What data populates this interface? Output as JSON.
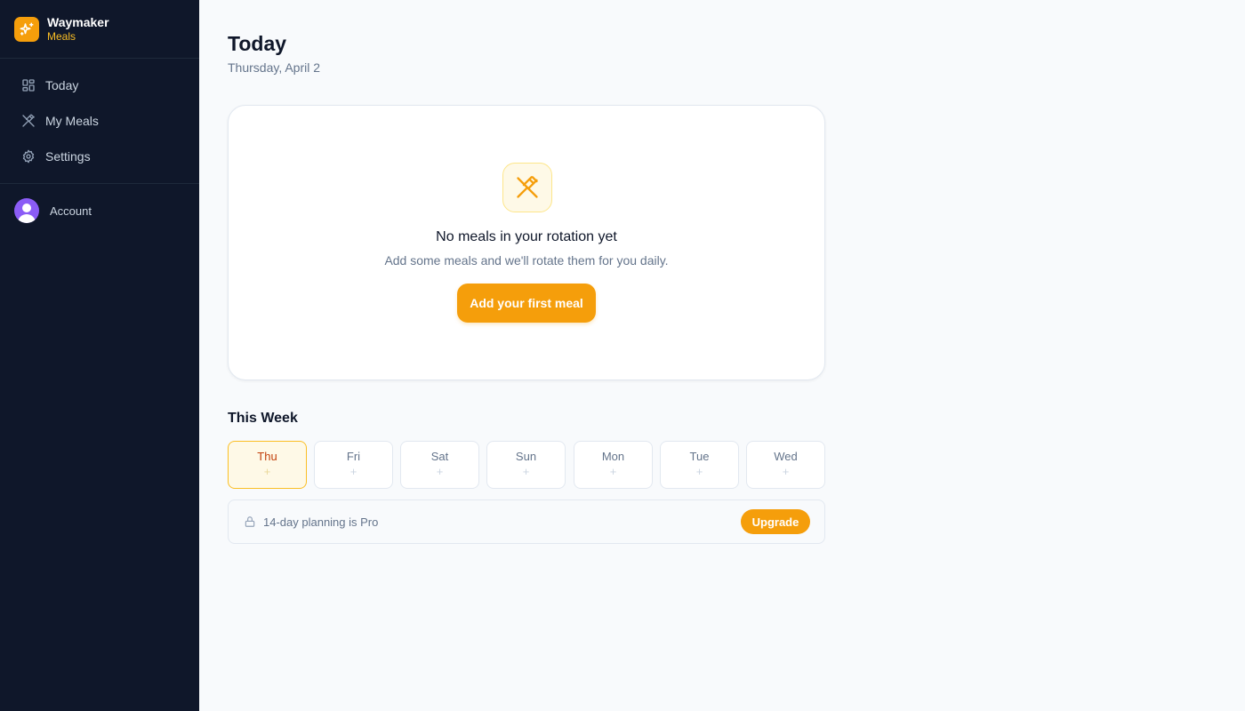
{
  "brand": {
    "name": "Waymaker",
    "subtitle": "Meals",
    "logo_icon": "sparkles-icon",
    "accent": "#f59e0b"
  },
  "sidebar": {
    "items": [
      {
        "label": "Today",
        "icon": "dashboard-icon"
      },
      {
        "label": "My Meals",
        "icon": "utensils-crossed-icon"
      },
      {
        "label": "Settings",
        "icon": "gear-icon"
      }
    ],
    "account": {
      "label": "Account",
      "icon": "user-avatar"
    }
  },
  "header": {
    "title": "Today",
    "date": "Thursday, April 2"
  },
  "empty_state": {
    "icon": "utensils-crossed-icon",
    "title": "No meals in your rotation yet",
    "description": "Add some meals and we'll rotate them for you daily.",
    "button": "Add your first meal"
  },
  "week": {
    "title": "This Week",
    "days": [
      {
        "name": "Thu",
        "plus": "+",
        "active": true
      },
      {
        "name": "Fri",
        "plus": "+"
      },
      {
        "name": "Sat",
        "plus": "+"
      },
      {
        "name": "Sun",
        "plus": "+"
      },
      {
        "name": "Mon",
        "plus": "+"
      },
      {
        "name": "Tue",
        "plus": "+"
      },
      {
        "name": "Wed",
        "plus": "+"
      }
    ]
  },
  "pro_banner": {
    "icon": "lock-icon",
    "text": "14-day planning is Pro",
    "button": "Upgrade"
  }
}
